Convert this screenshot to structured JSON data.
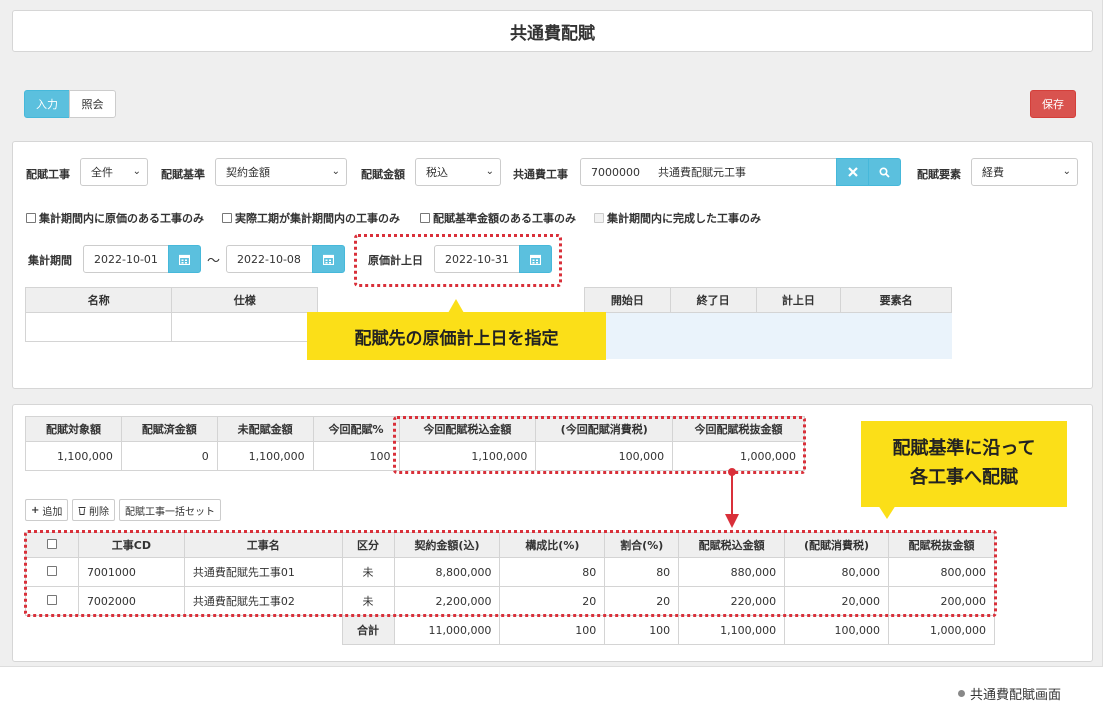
{
  "page_title": "共通費配賦",
  "mode_tabs": {
    "input": "入力",
    "view": "照会"
  },
  "save_label": "保存",
  "filters": {
    "alloc_work_label": "配賦工事",
    "alloc_work_value": "全件",
    "alloc_basis_label": "配賦基準",
    "alloc_basis_value": "契約金額",
    "alloc_amount_label": "配賦金額",
    "alloc_amount_value": "税込",
    "common_work_label": "共通費工事",
    "common_work_code": "7000000",
    "common_work_name": "共通費配賦元工事",
    "element_label": "配賦要素",
    "element_value": "経費"
  },
  "checkboxes": [
    "集計期間内に原価のある工事のみ",
    "実際工期が集計期間内の工事のみ",
    "配賦基準金額のある工事のみ",
    "集計期間内に完成した工事のみ"
  ],
  "period": {
    "label": "集計期間",
    "from": "2022-10-01",
    "tilde": "〜",
    "to": "2022-10-08",
    "cost_date_label": "原価計上日",
    "cost_date": "2022-10-31"
  },
  "search_table_headers": {
    "name": "名称",
    "spec": "仕様",
    "start": "開始日",
    "end": "終了日",
    "posted": "計上日",
    "element": "要素名"
  },
  "callout1": "配賦先の原価計上日を指定",
  "callout2_line1": "配賦基準に沿って",
  "callout2_line2": "各工事へ配賦",
  "summary": {
    "headers": [
      "配賦対象額",
      "配賦済金額",
      "未配賦金額",
      "今回配賦%",
      "今回配賦税込金額",
      "(今回配賦消費税)",
      "今回配賦税抜金額"
    ],
    "values": [
      "1,100,000",
      "0",
      "1,100,000",
      "100",
      "1,100,000",
      "100,000",
      "1,000,000"
    ]
  },
  "actions": {
    "add": "追加",
    "delete": "削除",
    "bulk": "配賦工事一括セット"
  },
  "detail": {
    "headers": [
      "工事CD",
      "工事名",
      "区分",
      "契約金額(込)",
      "構成比(%)",
      "割合(%)",
      "配賦税込金額",
      "(配賦消費税)",
      "配賦税抜金額"
    ],
    "rows": [
      [
        "7001000",
        "共通費配賦先工事01",
        "未",
        "8,800,000",
        "80",
        "80",
        "880,000",
        "80,000",
        "800,000"
      ],
      [
        "7002000",
        "共通費配賦先工事02",
        "未",
        "2,200,000",
        "20",
        "20",
        "220,000",
        "20,000",
        "200,000"
      ]
    ],
    "total_label": "合計",
    "totals": [
      "11,000,000",
      "100",
      "100",
      "1,100,000",
      "100,000",
      "1,000,000"
    ]
  },
  "caption": "共通費配賦画面",
  "colors": {
    "accent": "#5bc0de",
    "danger": "#d9534f",
    "highlight": "#fbdf18",
    "annotation": "#d9303a"
  }
}
